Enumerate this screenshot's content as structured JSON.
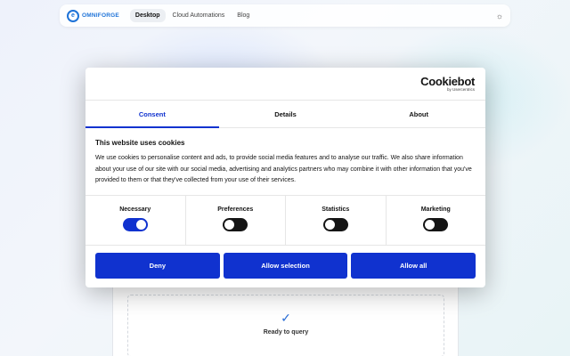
{
  "nav": {
    "logo_mark": "e",
    "logo_text": "OMNIFORGE",
    "links": [
      "Desktop",
      "Cloud Automations",
      "Blog"
    ],
    "theme_icon": "☼"
  },
  "background": {
    "check_icon": "✓",
    "status_text": "Ready to query"
  },
  "dialog": {
    "brand": "Cookiebot",
    "brand_sub": "by Usercentrics",
    "tabs": [
      "Consent",
      "Details",
      "About"
    ],
    "active_tab": "Consent",
    "title": "This website uses cookies",
    "body": "We use cookies to personalise content and ads, to provide social media features and to analyse our traffic. We also share information about your use of our site with our social media, advertising and analytics partners who may combine it with other information that you've provided to them or that they've collected from your use of their services.",
    "toggles": [
      {
        "label": "Necessary",
        "on": true
      },
      {
        "label": "Preferences",
        "on": false
      },
      {
        "label": "Statistics",
        "on": false
      },
      {
        "label": "Marketing",
        "on": false
      }
    ],
    "buttons": [
      "Deny",
      "Allow selection",
      "Allow all"
    ],
    "accent_color": "#1032cf"
  }
}
